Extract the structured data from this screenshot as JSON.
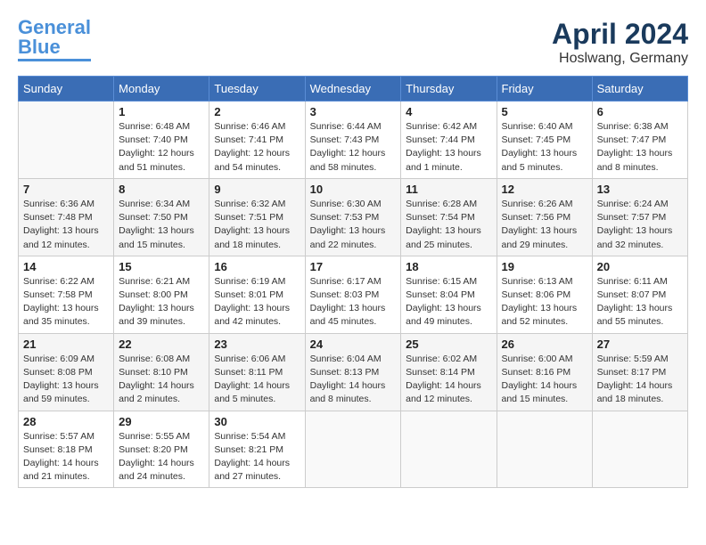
{
  "header": {
    "logo_general": "General",
    "logo_blue": "Blue",
    "month_title": "April 2024",
    "location": "Hoslwang, Germany"
  },
  "weekdays": [
    "Sunday",
    "Monday",
    "Tuesday",
    "Wednesday",
    "Thursday",
    "Friday",
    "Saturday"
  ],
  "weeks": [
    [
      {
        "num": "",
        "detail": ""
      },
      {
        "num": "1",
        "detail": "Sunrise: 6:48 AM\nSunset: 7:40 PM\nDaylight: 12 hours\nand 51 minutes."
      },
      {
        "num": "2",
        "detail": "Sunrise: 6:46 AM\nSunset: 7:41 PM\nDaylight: 12 hours\nand 54 minutes."
      },
      {
        "num": "3",
        "detail": "Sunrise: 6:44 AM\nSunset: 7:43 PM\nDaylight: 12 hours\nand 58 minutes."
      },
      {
        "num": "4",
        "detail": "Sunrise: 6:42 AM\nSunset: 7:44 PM\nDaylight: 13 hours\nand 1 minute."
      },
      {
        "num": "5",
        "detail": "Sunrise: 6:40 AM\nSunset: 7:45 PM\nDaylight: 13 hours\nand 5 minutes."
      },
      {
        "num": "6",
        "detail": "Sunrise: 6:38 AM\nSunset: 7:47 PM\nDaylight: 13 hours\nand 8 minutes."
      }
    ],
    [
      {
        "num": "7",
        "detail": "Sunrise: 6:36 AM\nSunset: 7:48 PM\nDaylight: 13 hours\nand 12 minutes."
      },
      {
        "num": "8",
        "detail": "Sunrise: 6:34 AM\nSunset: 7:50 PM\nDaylight: 13 hours\nand 15 minutes."
      },
      {
        "num": "9",
        "detail": "Sunrise: 6:32 AM\nSunset: 7:51 PM\nDaylight: 13 hours\nand 18 minutes."
      },
      {
        "num": "10",
        "detail": "Sunrise: 6:30 AM\nSunset: 7:53 PM\nDaylight: 13 hours\nand 22 minutes."
      },
      {
        "num": "11",
        "detail": "Sunrise: 6:28 AM\nSunset: 7:54 PM\nDaylight: 13 hours\nand 25 minutes."
      },
      {
        "num": "12",
        "detail": "Sunrise: 6:26 AM\nSunset: 7:56 PM\nDaylight: 13 hours\nand 29 minutes."
      },
      {
        "num": "13",
        "detail": "Sunrise: 6:24 AM\nSunset: 7:57 PM\nDaylight: 13 hours\nand 32 minutes."
      }
    ],
    [
      {
        "num": "14",
        "detail": "Sunrise: 6:22 AM\nSunset: 7:58 PM\nDaylight: 13 hours\nand 35 minutes."
      },
      {
        "num": "15",
        "detail": "Sunrise: 6:21 AM\nSunset: 8:00 PM\nDaylight: 13 hours\nand 39 minutes."
      },
      {
        "num": "16",
        "detail": "Sunrise: 6:19 AM\nSunset: 8:01 PM\nDaylight: 13 hours\nand 42 minutes."
      },
      {
        "num": "17",
        "detail": "Sunrise: 6:17 AM\nSunset: 8:03 PM\nDaylight: 13 hours\nand 45 minutes."
      },
      {
        "num": "18",
        "detail": "Sunrise: 6:15 AM\nSunset: 8:04 PM\nDaylight: 13 hours\nand 49 minutes."
      },
      {
        "num": "19",
        "detail": "Sunrise: 6:13 AM\nSunset: 8:06 PM\nDaylight: 13 hours\nand 52 minutes."
      },
      {
        "num": "20",
        "detail": "Sunrise: 6:11 AM\nSunset: 8:07 PM\nDaylight: 13 hours\nand 55 minutes."
      }
    ],
    [
      {
        "num": "21",
        "detail": "Sunrise: 6:09 AM\nSunset: 8:08 PM\nDaylight: 13 hours\nand 59 minutes."
      },
      {
        "num": "22",
        "detail": "Sunrise: 6:08 AM\nSunset: 8:10 PM\nDaylight: 14 hours\nand 2 minutes."
      },
      {
        "num": "23",
        "detail": "Sunrise: 6:06 AM\nSunset: 8:11 PM\nDaylight: 14 hours\nand 5 minutes."
      },
      {
        "num": "24",
        "detail": "Sunrise: 6:04 AM\nSunset: 8:13 PM\nDaylight: 14 hours\nand 8 minutes."
      },
      {
        "num": "25",
        "detail": "Sunrise: 6:02 AM\nSunset: 8:14 PM\nDaylight: 14 hours\nand 12 minutes."
      },
      {
        "num": "26",
        "detail": "Sunrise: 6:00 AM\nSunset: 8:16 PM\nDaylight: 14 hours\nand 15 minutes."
      },
      {
        "num": "27",
        "detail": "Sunrise: 5:59 AM\nSunset: 8:17 PM\nDaylight: 14 hours\nand 18 minutes."
      }
    ],
    [
      {
        "num": "28",
        "detail": "Sunrise: 5:57 AM\nSunset: 8:18 PM\nDaylight: 14 hours\nand 21 minutes."
      },
      {
        "num": "29",
        "detail": "Sunrise: 5:55 AM\nSunset: 8:20 PM\nDaylight: 14 hours\nand 24 minutes."
      },
      {
        "num": "30",
        "detail": "Sunrise: 5:54 AM\nSunset: 8:21 PM\nDaylight: 14 hours\nand 27 minutes."
      },
      {
        "num": "",
        "detail": ""
      },
      {
        "num": "",
        "detail": ""
      },
      {
        "num": "",
        "detail": ""
      },
      {
        "num": "",
        "detail": ""
      }
    ]
  ]
}
